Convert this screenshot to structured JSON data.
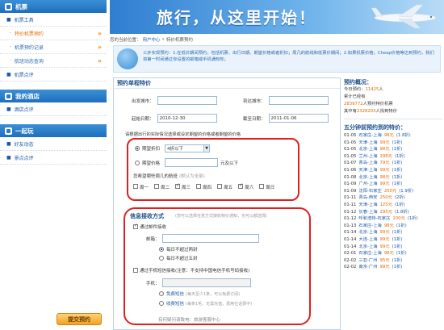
{
  "sidebar": {
    "sections": [
      {
        "title": "机票",
        "items": [
          {
            "label": "机票工具",
            "type": "group"
          },
          {
            "label": "特价机票预约",
            "type": "sub",
            "active": true
          },
          {
            "label": "机票预约记录",
            "type": "sub"
          },
          {
            "label": "航班动态查询",
            "type": "sub"
          },
          {
            "label": "机票点评",
            "type": "group"
          }
        ]
      },
      {
        "title": "我的酒店",
        "items": [
          {
            "label": "酒店点评",
            "type": "group"
          }
        ]
      },
      {
        "title": "一起玩",
        "items": [
          {
            "label": "好友动态",
            "type": "group"
          },
          {
            "label": "景点点评",
            "type": "group"
          }
        ]
      }
    ],
    "arrow": "»"
  },
  "banner": {
    "slogan": "旅行，从这里开始！"
  },
  "breadcrumb": {
    "prefix": "您的当前位置：",
    "link": "用户中心",
    "sep": "»",
    "current": "特价机票预约"
  },
  "intro": {
    "text": "三步实现预约：1.在低价期间预约，包括机票、出行日期、期望价格或者折扣；周几的航线和低票价期间；2.如果机票价格；Cheap价格等达到预约，我们将第一时间通过你设置的邮箱或手机通知你。"
  },
  "form": {
    "title": "预约单程特价",
    "from_label": "出发城市：",
    "from_value": "",
    "to_label": "到达城市：",
    "to_value": "",
    "start_label": "起始日期：",
    "start_value": "2010-12-30",
    "end_label": "截至日期：",
    "end_value": "2011-01-06",
    "notice": "请根据出行的实际情况选择或设定期望的价格或者期望的价格",
    "opt1_label": "期望折扣",
    "opt1_select": "4折以下",
    "opt2_label": "期望价格",
    "opt2_suffix": "元及以下",
    "weekday_hint": "您希望哪些周几的航班",
    "weekday_hint2": "(默认为全部)",
    "weekdays": [
      {
        "label": "周一",
        "checked": false
      },
      {
        "label": "周二",
        "checked": false
      },
      {
        "label": "周三",
        "checked": true
      },
      {
        "label": "周四",
        "checked": false
      },
      {
        "label": "周五",
        "checked": false
      },
      {
        "label": "周六",
        "checked": true
      },
      {
        "label": "周日",
        "checked": false
      }
    ],
    "receive_title": "信息接收方式",
    "receive_hint": "(您可以选择任意方式接收特价通知，也可以都选择)",
    "email_check": "通过邮件接收",
    "email_label": "邮箱：",
    "email_value": "",
    "email_opt1": "每日不超过两封",
    "email_opt2": "每日不超过五封",
    "sms_check": "通过手机短信接收(注意：不支持中国电信手机号码接收)",
    "phone_label": "手机：",
    "phone_value": "",
    "sms_opt1": "免费短信",
    "sms_opt1_note": "(每天至少1条，可以免费订阅)",
    "sms_opt2": "收费短信",
    "sms_opt2_note": "(每条1毛，无需充值，费用在话费中)",
    "submit": "提交预约",
    "footnote": "有何疑问请致电：旅游客服中心"
  },
  "right": {
    "overview_title": "预约概况：",
    "line1_pre": "今日预约：",
    "line1_num": "11425",
    "line1_suf": "人",
    "line2": "累计已经有",
    "line3_num": "2839772",
    "line3_suf": "人预约特价机票",
    "line4_pre": "其中有",
    "line4_num": "2328203",
    "line4_suf": "人找到特价",
    "list_title": "五分钟前预约到的特价：",
    "items": [
      {
        "date": "01-05",
        "route": "石家庄-上海",
        "price": "98元",
        "disc": "(1.8折)"
      },
      {
        "date": "01-05",
        "route": "天津-上海",
        "price": "99元",
        "disc": "(1折)"
      },
      {
        "date": "01-05",
        "route": "北京-上海",
        "price": "98元",
        "disc": "(1折)"
      },
      {
        "date": "01-05",
        "route": "兰州-上海",
        "price": "298元",
        "disc": "(1折)"
      },
      {
        "date": "01-07",
        "route": "青岛-上海",
        "price": "79元",
        "disc": "(1折)"
      },
      {
        "date": "01-06",
        "route": "天津-上海",
        "price": "99元",
        "disc": "(1折)"
      },
      {
        "date": "01-08",
        "route": "北京-上海",
        "price": "98元",
        "disc": "(1折)"
      },
      {
        "date": "01-09",
        "route": "广州-上海",
        "price": "99元",
        "disc": "(1折)"
      },
      {
        "date": "01-09",
        "route": "沈阳-石家庄",
        "price": "250元",
        "disc": "(1.9折)"
      },
      {
        "date": "01-11",
        "route": "青岛-西安",
        "price": "250元",
        "disc": "(2折)"
      },
      {
        "date": "01-11",
        "route": "天津-上海",
        "price": "125元",
        "disc": "(1折)"
      },
      {
        "date": "01-12",
        "route": "长春-上海",
        "price": "295元",
        "disc": "(1.8折)"
      },
      {
        "date": "01-12",
        "route": "呼和浩特-石家庄",
        "price": "100元",
        "disc": "(1折)"
      },
      {
        "date": "01-13",
        "route": "石家庄-上海",
        "price": "98元",
        "disc": "(1折)"
      },
      {
        "date": "01-14",
        "route": "北京-上海",
        "price": "99元",
        "disc": "(1折)"
      },
      {
        "date": "01-14",
        "route": "大连-上海",
        "price": "99元",
        "disc": "(1折)"
      },
      {
        "date": "01-14",
        "route": "北京-上海",
        "price": "99元",
        "disc": "(1折)"
      },
      {
        "date": "02-01",
        "route": "石家庄-上海",
        "price": "98元",
        "disc": "(1折)"
      },
      {
        "date": "02-02",
        "route": "三亚-广州",
        "price": "95元",
        "disc": "(1折)"
      },
      {
        "date": "02-02",
        "route": "南京-广州",
        "price": "99元",
        "disc": "(1折)"
      }
    ]
  }
}
